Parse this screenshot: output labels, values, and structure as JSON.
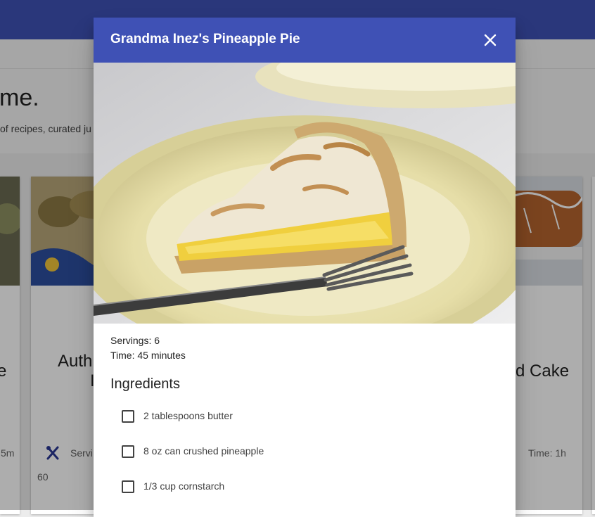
{
  "background": {
    "hero": {
      "title": "me.",
      "subtitle": "of recipes, curated ju"
    },
    "cards": [
      {
        "title": "e",
        "meta_time": "5m"
      },
      {
        "title": "Auth",
        "title_line2": "I",
        "meta_servings": "Servi",
        "meta_extra": "60"
      },
      {
        "title": "d Cake",
        "meta_time": "Time: 1h"
      }
    ]
  },
  "dialog": {
    "title": "Grandma Inez's Pineapple Pie",
    "close_icon": "close-icon",
    "servings": "Servings: 6",
    "time": "Time: 45 minutes",
    "ingredients_heading": "Ingredients",
    "ingredients": [
      {
        "label": "2 tablespoons butter",
        "checked": false
      },
      {
        "label": "8 oz can crushed pineapple",
        "checked": false
      },
      {
        "label": "1/3 cup cornstarch",
        "checked": false
      }
    ]
  },
  "colors": {
    "primary": "#3f51b5",
    "dialog_header": "#3f51b5",
    "text": "#212121"
  }
}
